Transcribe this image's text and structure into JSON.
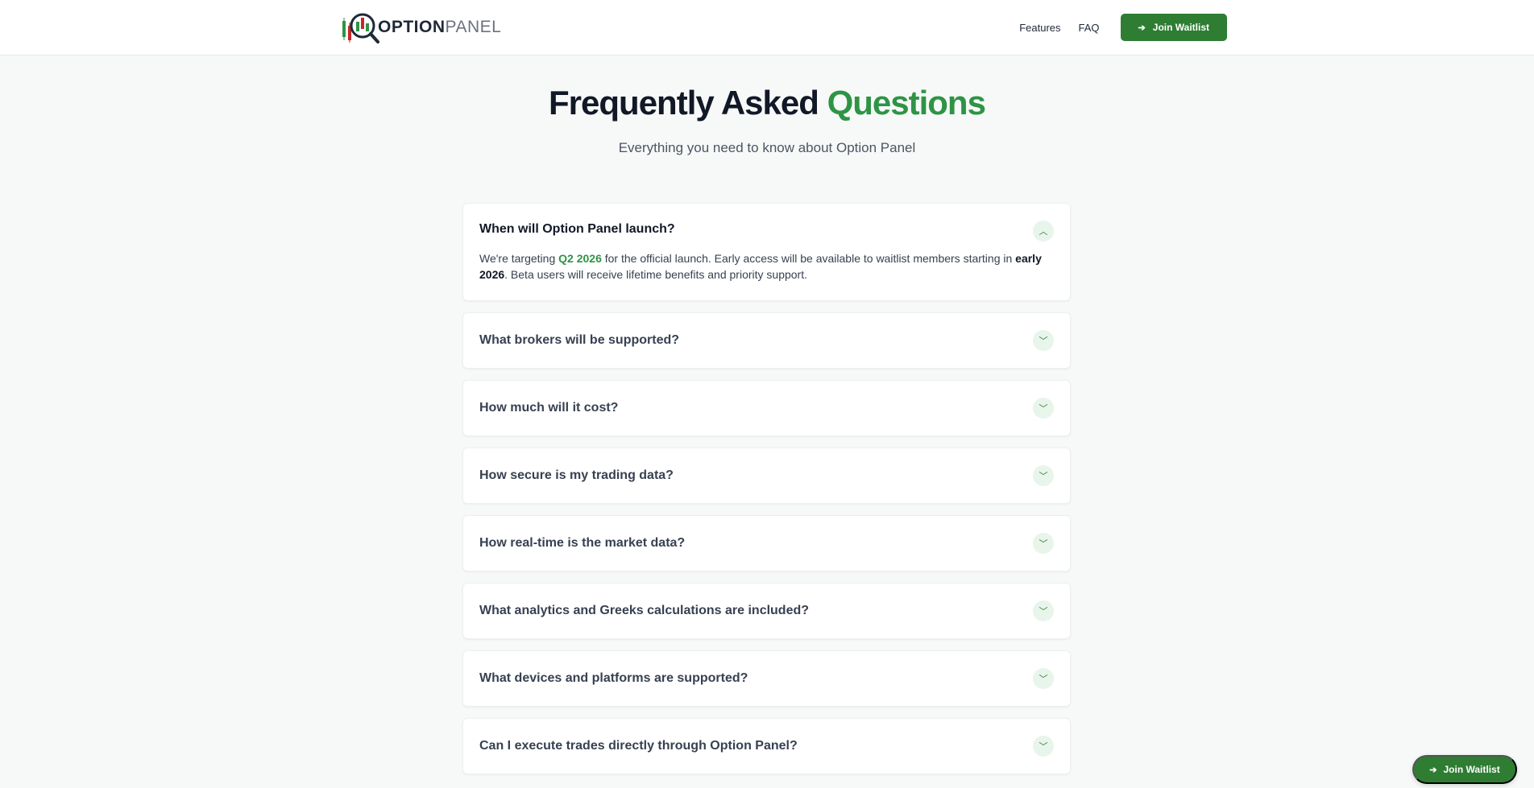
{
  "header": {
    "logo_text_1": "OPTION",
    "logo_text_2": "PANEL",
    "nav": [
      "Features",
      "FAQ"
    ],
    "cta_label": "Join Waitlist",
    "cta_icon": "arrow-right-icon"
  },
  "hero": {
    "title_main": "Frequently Asked ",
    "title_accent": "Questions",
    "subtitle": "Everything you need to know about Option Panel"
  },
  "faq": {
    "items": [
      {
        "question": "When will Option Panel launch?",
        "open": true
      },
      {
        "question": "What brokers will be supported?",
        "open": false
      },
      {
        "question": "How much will it cost?",
        "open": false
      },
      {
        "question": "How secure is my trading data?",
        "open": false
      },
      {
        "question": "How real-time is the market data?",
        "open": false
      },
      {
        "question": "What analytics and Greeks calculations are included?",
        "open": false
      },
      {
        "question": "What devices and platforms are supported?",
        "open": false
      },
      {
        "question": "Can I execute trades directly through Option Panel?",
        "open": false
      }
    ],
    "answer0": {
      "p1": "We're targeting ",
      "hl1": "Q2 2026",
      "p2": " for the official launch. Early access will be available to waitlist members starting in ",
      "b1": "early 2026",
      "p3": ". Beta users will receive lifetime benefits and priority support."
    }
  },
  "floating_cta": {
    "label": "Join Waitlist"
  },
  "colors": {
    "brand_green": "#2e7d32",
    "accent_green": "#2e9445",
    "background": "#f7f9f8"
  }
}
